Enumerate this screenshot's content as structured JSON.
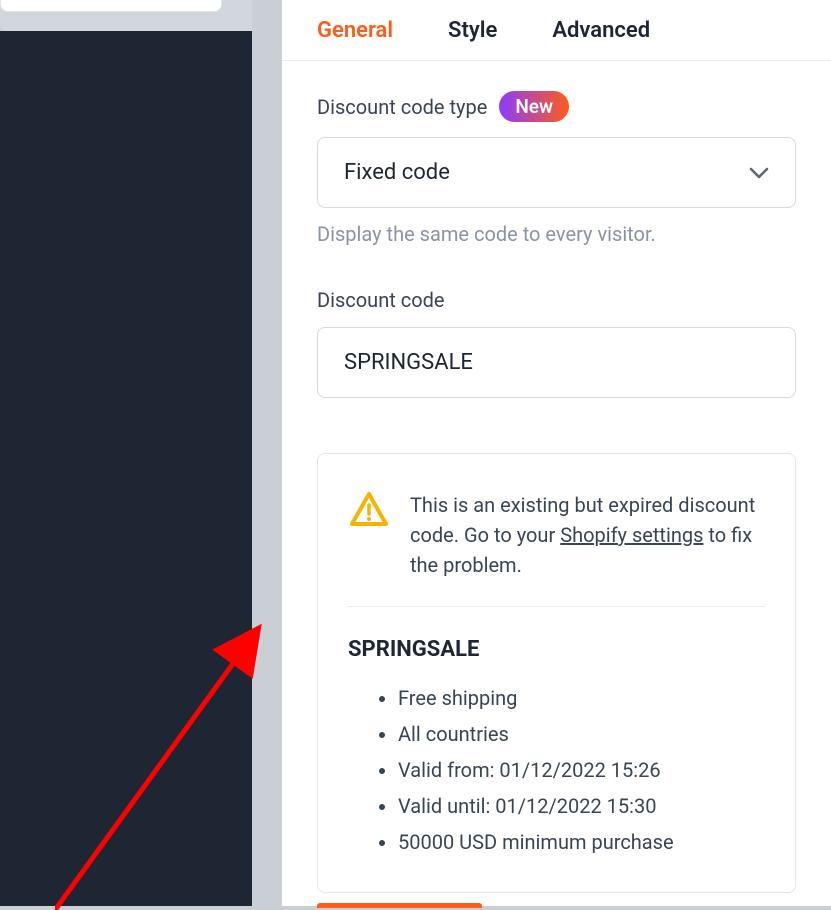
{
  "tabs": {
    "general": "General",
    "style": "Style",
    "advanced": "Advanced"
  },
  "discount_type": {
    "label": "Discount code type",
    "badge": "New",
    "value": "Fixed code",
    "hint": "Display the same code to every visitor."
  },
  "discount_code": {
    "label": "Discount code",
    "value": "SPRINGSALE"
  },
  "warning": {
    "text_before": "This is an existing but expired discount code. Go to your ",
    "link": "Shopify settings",
    "text_after": " to fix the problem."
  },
  "details": {
    "code_name": "SPRINGSALE",
    "items": [
      "Free shipping",
      "All countries",
      "Valid from: 01/12/2022 15:26",
      "Valid until: 01/12/2022 15:30",
      "50000 USD minimum purchase"
    ]
  }
}
